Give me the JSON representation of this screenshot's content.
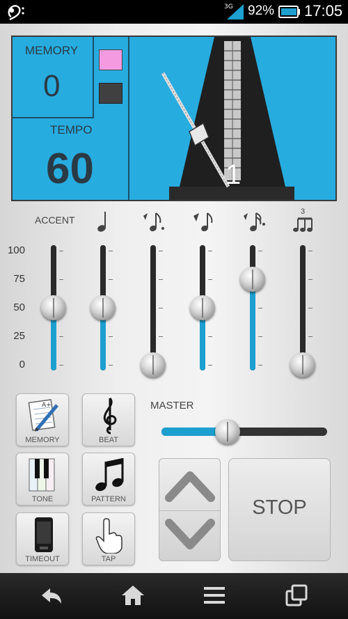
{
  "status_bar": {
    "network": "3G",
    "battery_percent": "92%",
    "time": "17:05",
    "app_icon": "bass-clef-icon"
  },
  "display": {
    "memory_label": "MEMORY",
    "memory_value": "0",
    "tempo_label": "TEMPO",
    "tempo_value": "60",
    "beat_count": "1",
    "pink_color": "#f39ae0",
    "screen_color": "#27ace0"
  },
  "mixer": {
    "accent_label": "ACCENT",
    "triplet_label": "3",
    "scale": [
      "100",
      "75",
      "50",
      "25",
      "0"
    ],
    "channels": [
      {
        "id": "accent",
        "icon": "accent-label",
        "level": 50
      },
      {
        "id": "quarter",
        "icon": "quarter-note-icon",
        "level": 50
      },
      {
        "id": "eighth",
        "icon": "eighth-note-icon",
        "level": 0
      },
      {
        "id": "eighth-rest",
        "icon": "eighth-rest-note-icon",
        "level": 50
      },
      {
        "id": "sixteenth",
        "icon": "sixteenth-note-icon",
        "level": 75
      },
      {
        "id": "triplet",
        "icon": "triplet-note-icon",
        "level": 0
      }
    ]
  },
  "buttons": {
    "memory": "MEMORY",
    "beat": "BEAT",
    "tone": "TONE",
    "pattern": "PATTERN",
    "timeout": "TIMEOUT",
    "tap": "TAP"
  },
  "master": {
    "label": "MASTER",
    "level": 40
  },
  "controls": {
    "stop_label": "STOP"
  },
  "colors": {
    "accent_blue": "#1d9fcf"
  }
}
